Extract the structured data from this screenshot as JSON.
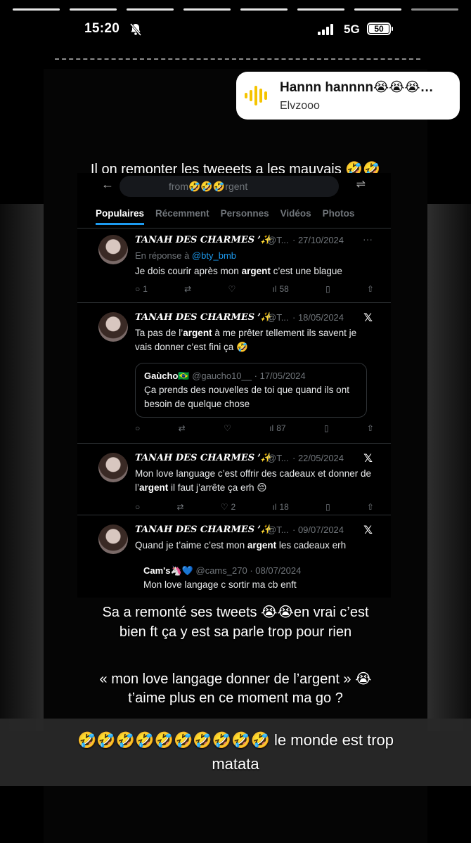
{
  "status_bar": {
    "time": "15:20",
    "network": "5G",
    "battery": "50"
  },
  "music": {
    "title": "Hannn hannnn😭😭😭…",
    "artist": "Elvzooo"
  },
  "captions": {
    "top": "Il on remonter les tweeets a les mauvais 🤣🤣",
    "mid1": "Sa a remonté ses tweets 😭😭en vrai c’est",
    "mid2": "bien ft ça y est sa parle trop pour rien",
    "quote1": "« mon love langage donner de l’argent » 😭",
    "quote2": "t’aime plus en ce moment ma go ?",
    "bottom1": "🤣🤣🤣🤣🤣🤣🤣🤣🤣🤣 le monde est trop",
    "bottom2": "matata"
  },
  "twitter": {
    "search_text": "from🤣🤣🤣rgent",
    "tabs": [
      "Populaires",
      "Récemment",
      "Personnes",
      "Vidéos",
      "Photos"
    ],
    "tweets": [
      {
        "name": "TANAH DES CHARMES ՚✨",
        "handle": "@T...",
        "date": "· 27/10/2024",
        "reply_prefix": "En réponse à ",
        "reply_to": "@bty_bmb",
        "text_a": "Je dois courir après mon ",
        "text_bold": "argent",
        "text_b": " c’est une blague",
        "replies": "1",
        "likes": "",
        "views": "58"
      },
      {
        "name": "TANAH DES CHARMES ՚✨",
        "handle": "@T...",
        "date": "· 18/05/2024",
        "text_a": "Ta pas de l’",
        "text_bold": "argent",
        "text_b": " à me prêter tellement ils savent je vais donner c’est fini ça 🤣",
        "quote_name": "Gaùcho🇧🇷",
        "quote_handle": "@gaucho10__",
        "quote_date": "· 17/05/2024",
        "quote_text": "Ça prends des nouvelles de toi que quand ils ont besoin de quelque chose",
        "views": "87"
      },
      {
        "name": "TANAH DES CHARMES ՚✨",
        "handle": "@T...",
        "date": "· 22/05/2024",
        "text_a": "Mon love language c’est offrir des cadeaux et donner de l’",
        "text_bold": "argent",
        "text_b": " il faut j’arrête ça erh 😔",
        "likes": "2",
        "views": "18"
      },
      {
        "name": "TANAH DES CHARMES ՚✨",
        "handle": "@T...",
        "date": "· 09/07/2024",
        "text_a": "Quand je t’aime c’est mon ",
        "text_bold": "argent",
        "text_b": " les cadeaux erh",
        "quote_name": "Cam's🦄💙",
        "quote_handle": "@cams_270",
        "quote_date": "· 08/07/2024",
        "quote_text": "Mon love langage c sortir ma cb enft"
      }
    ]
  }
}
